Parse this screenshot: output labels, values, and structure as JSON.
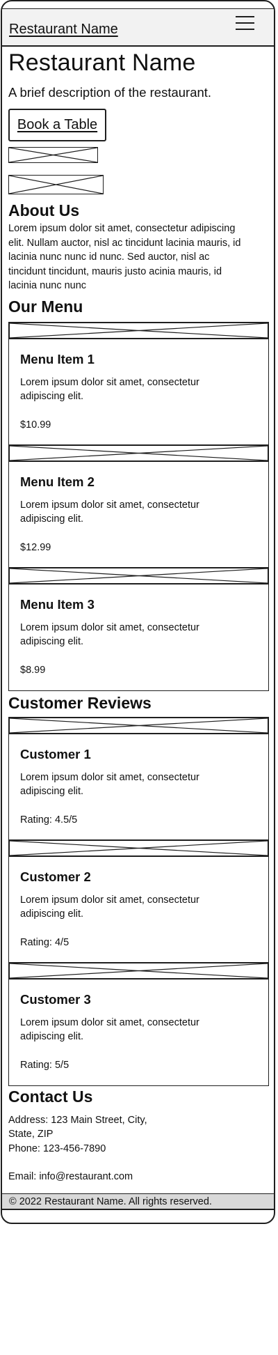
{
  "header": {
    "brand": "Restaurant Name",
    "menu_icon": "hamburger-menu-icon"
  },
  "hero": {
    "title": "Restaurant Name",
    "description": "A brief description of the  restaurant.",
    "cta_label": "Book a Table"
  },
  "about": {
    "title": "About Us",
    "text": "Lorem ipsum dolor sit amet, consectetur adipiscing elit. Nullam auctor, nisl ac tincidunt lacinia mauris, id lacinia nunc nunc id nunc. Sed auctor, nisl ac tincidunt tincidunt, mauris justo acinia mauris, id lacinia nunc nunc"
  },
  "menu": {
    "title": "Our Menu",
    "items": [
      {
        "name": "Menu Item 1",
        "description": "Lorem ipsum dolor sit amet, consectetur adipiscing elit.",
        "price": "$10.99"
      },
      {
        "name": "Menu Item 2",
        "description": "Lorem ipsum dolor sit amet, consectetur adipiscing elit.",
        "price": "$12.99"
      },
      {
        "name": "Menu Item 3",
        "description": "Lorem ipsum dolor sit amet, consectetur adipiscing elit.",
        "price": "$8.99"
      }
    ]
  },
  "reviews": {
    "title": "Customer Reviews",
    "items": [
      {
        "name": "Customer 1",
        "text": "Lorem ipsum dolor sit amet, consectetur adipiscing elit.",
        "rating": "Rating: 4.5/5"
      },
      {
        "name": "Customer 2",
        "text": "Lorem ipsum dolor sit amet, consectetur adipiscing elit.",
        "rating": "Rating: 4/5"
      },
      {
        "name": "Customer 3",
        "text": "Lorem ipsum dolor sit amet, consectetur adipiscing elit.",
        "rating": "Rating: 5/5"
      }
    ]
  },
  "contact": {
    "title": "Contact Us",
    "address_line1": "Address: 123 Main Street, City,",
    "address_line2": "State, ZIP",
    "phone": "Phone: 123-456-7890",
    "email": "Email: info@restaurant.com"
  },
  "footer": {
    "text": "© 2022 Restaurant Name. All rights reserved."
  }
}
